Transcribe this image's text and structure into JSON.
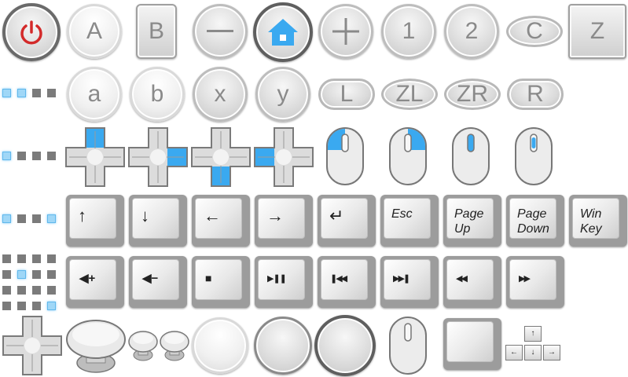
{
  "colors": {
    "accent_blue": "#3aa9f0",
    "power_red": "#d32a2a",
    "button_text": "#8a8a8a",
    "key_text": "#222222"
  },
  "row1": {
    "btn_a": "A",
    "btn_b": "B",
    "btn_1": "1",
    "btn_2": "2",
    "btn_c": "C",
    "btn_z": "Z",
    "icons": [
      "power-icon",
      "minus-icon",
      "home-icon",
      "plus-icon"
    ]
  },
  "row2": {
    "btn_a": "a",
    "btn_b": "b",
    "btn_x": "x",
    "btn_y": "y",
    "btn_l": "L",
    "btn_zl": "ZL",
    "btn_zr": "ZR",
    "btn_r": "R"
  },
  "row4": {
    "arrow_glyphs": [
      "↑",
      "↓",
      "←",
      "→",
      "↵"
    ],
    "esc": "Esc",
    "page_up": [
      "Page",
      "Up"
    ],
    "page_down": [
      "Page",
      "Down"
    ],
    "win_key": [
      "Win",
      "Key"
    ]
  },
  "row5": {
    "glyphs": [
      "◀+",
      "◀−",
      "■",
      "▶❚❚",
      "❚◀◀",
      "▶▶❚",
      "◀◀",
      "▶▶"
    ]
  },
  "arrow_keys_small": [
    "↑",
    "←",
    "↓",
    "→"
  ]
}
